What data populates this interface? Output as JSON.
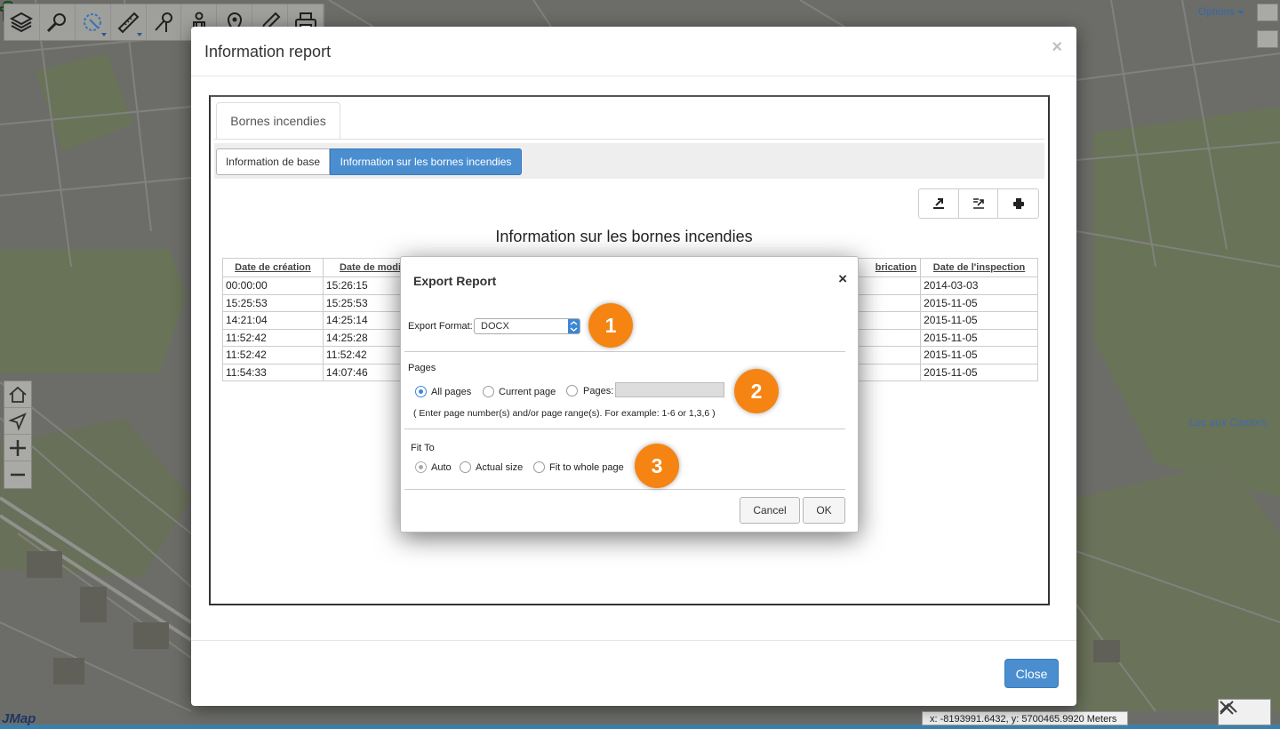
{
  "toolbar": {
    "options_label": "Options"
  },
  "map": {
    "lake_label": "Lac aux Castors",
    "logo_text": "JMap",
    "coordinates": "x: -8193991.6432, y: 5700465.9920 Meters"
  },
  "modal": {
    "title": "Information report",
    "close_symbol": "×",
    "main_tab": "Bornes incendies",
    "subtabs": [
      "Information de base",
      "Information sur les bornes incendies"
    ],
    "report_title": "Information sur les bornes incendies",
    "table": {
      "headers": [
        "Date de création",
        "Date de modif",
        "brication",
        "Date de l'inspection"
      ],
      "rows": [
        [
          "00:00:00",
          "15:26:15",
          "2014-03-03"
        ],
        [
          "15:25:53",
          "15:25:53",
          "2015-11-05"
        ],
        [
          "14:21:04",
          "14:25:14",
          "2015-11-05"
        ],
        [
          "11:52:42",
          "14:25:28",
          "2015-11-05"
        ],
        [
          "11:52:42",
          "11:52:42",
          "2015-11-05"
        ],
        [
          "11:54:33",
          "14:07:46",
          "2015-11-05"
        ]
      ]
    },
    "close_button": "Close"
  },
  "export_dialog": {
    "title": "Export Report",
    "close_symbol": "×",
    "format_label": "Export Format:",
    "format_value": "DOCX",
    "pages_label": "Pages",
    "pages_options": [
      "All pages",
      "Current page",
      "Pages:"
    ],
    "pages_hint": "( Enter page number(s) and/or page range(s). For example: 1-6 or 1,3,6 )",
    "fit_label": "Fit To",
    "fit_options": [
      "Auto",
      "Actual size",
      "Fit to whole page"
    ],
    "cancel_label": "Cancel",
    "ok_label": "OK"
  },
  "callouts": [
    "1",
    "2",
    "3"
  ],
  "colors": {
    "primary": "#4a8ed0",
    "callout": "#f58412",
    "map_bg": "#737470"
  },
  "icons": [
    "layers-icon",
    "search-icon",
    "select-icon",
    "measure-icon",
    "route-icon",
    "person-icon",
    "pin-icon",
    "edit-icon",
    "print-icon",
    "home-icon",
    "navigate-icon",
    "zoom-in-icon",
    "zoom-out-icon",
    "export-icon",
    "export-data-icon",
    "print-report-icon",
    "hydrant-icon",
    "collapse-icon",
    "close-x-icon"
  ]
}
